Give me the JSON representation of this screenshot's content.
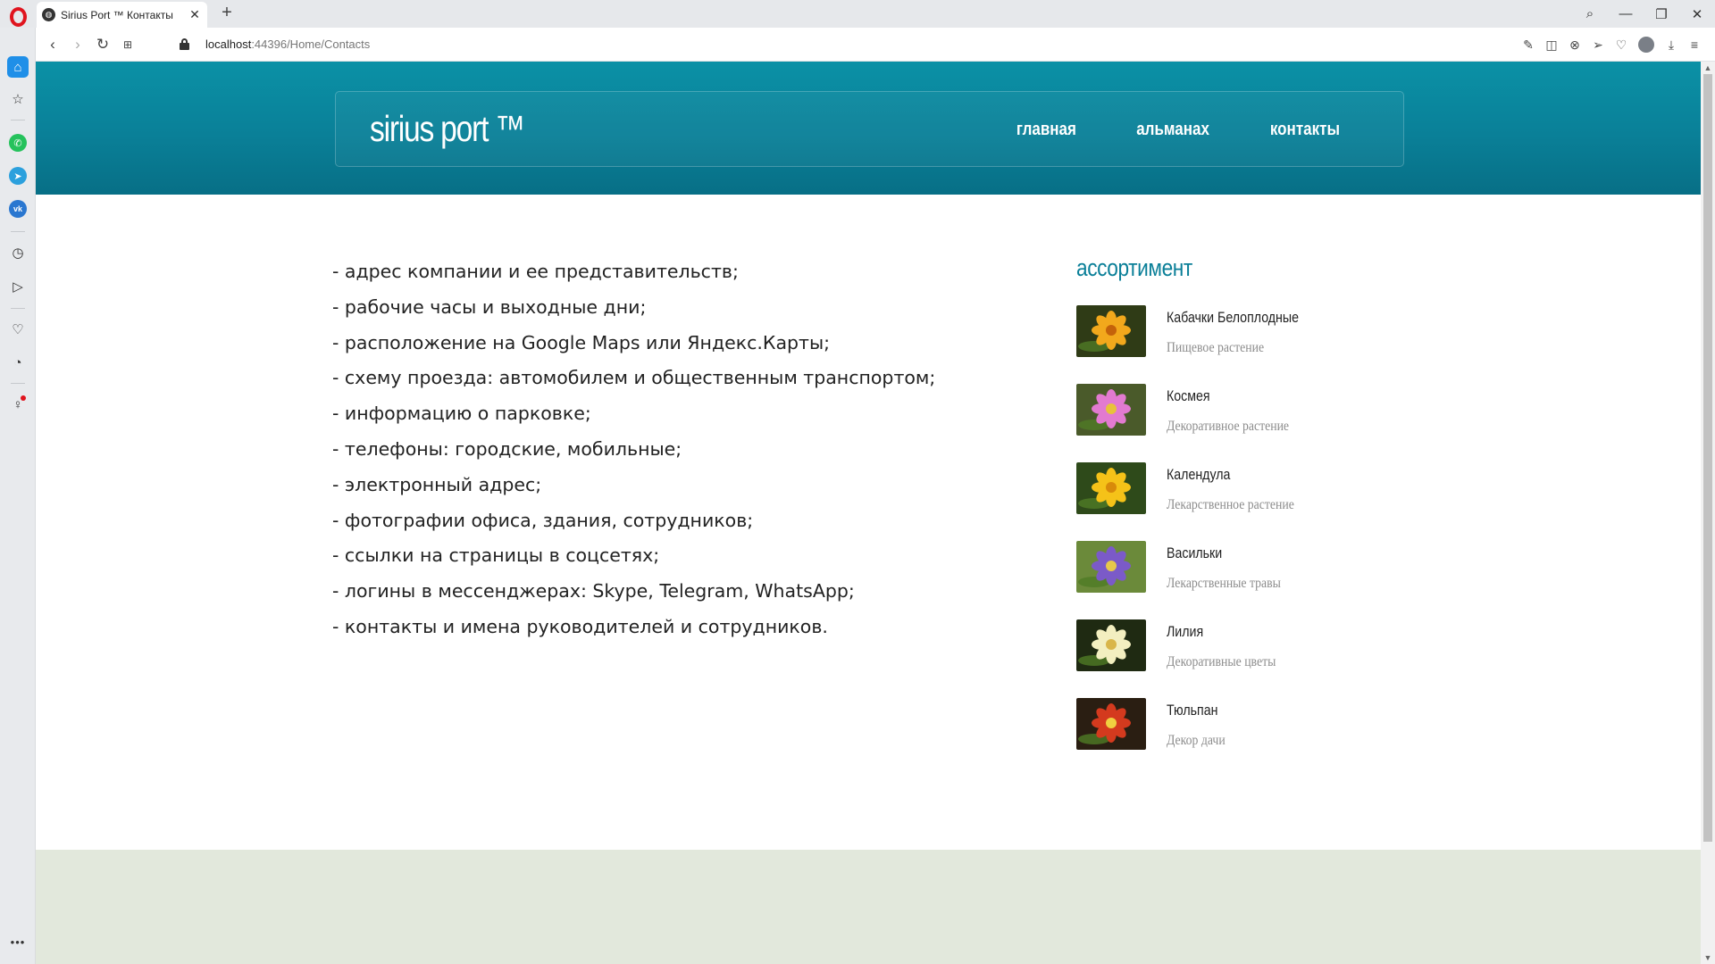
{
  "browser": {
    "tab_title": "Sirius Port ™ Контакты",
    "new_tab": "+",
    "url_host": "localhost",
    "url_path": ":44396/Home/Contacts"
  },
  "header": {
    "logo": "sirius port ™",
    "nav": [
      "главная",
      "альманах",
      "контакты"
    ]
  },
  "contacts_list": [
    "- адрес компании и ее представительств;",
    "- рабочие часы и выходные дни;",
    "- расположение на Google Maps или Яндекс.Карты;",
    "- схему проезда: автомобилем и общественным транспортом;",
    "- информацию о парковке;",
    "- телефоны: городские, мобильные;",
    "- электронный адрес;",
    "- фотографии офиса, здания, сотрудников;",
    "- ссылки на страницы в соцсетях;",
    "- логины в мессенджерах: Skype, Telegram, WhatsApp;",
    "- контакты и имена руководителей и сотрудников."
  ],
  "assortment": {
    "title": "ассортимент",
    "items": [
      {
        "name": "Кабачки Белоплодные",
        "desc": "Пищевое растение",
        "icon": "orange-flower-photo",
        "petal": "#f2a81c",
        "center": "#c4620a",
        "bg": "#2f3b16"
      },
      {
        "name": "Космея",
        "desc": "Декоративное растение",
        "icon": "pink-cosmos-photo",
        "petal": "#e27ad0",
        "center": "#e8c23a",
        "bg": "#4a5a2a"
      },
      {
        "name": "Календула",
        "desc": "Лекарственное растение",
        "icon": "yellow-calendula-photo",
        "petal": "#f5c218",
        "center": "#d88a0a",
        "bg": "#2e4a1a"
      },
      {
        "name": "Васильки",
        "desc": "Лекарственные травы",
        "icon": "cornflower-photo",
        "petal": "#7b5ac8",
        "center": "#e7c84a",
        "bg": "#6b8a3a"
      },
      {
        "name": "Лилия",
        "desc": "Декоративные цветы",
        "icon": "lily-photo",
        "petal": "#f3efc0",
        "center": "#d9b64a",
        "bg": "#1f2a12"
      },
      {
        "name": "Тюльпан",
        "desc": "Декор дачи",
        "icon": "tulip-photo",
        "petal": "#d43a1e",
        "center": "#f0d040",
        "bg": "#2a1e12"
      }
    ]
  },
  "colors": {
    "header_teal": "#0a8098",
    "accent_teal": "#0a7f98",
    "footer_bg": "#e2e8dc"
  }
}
